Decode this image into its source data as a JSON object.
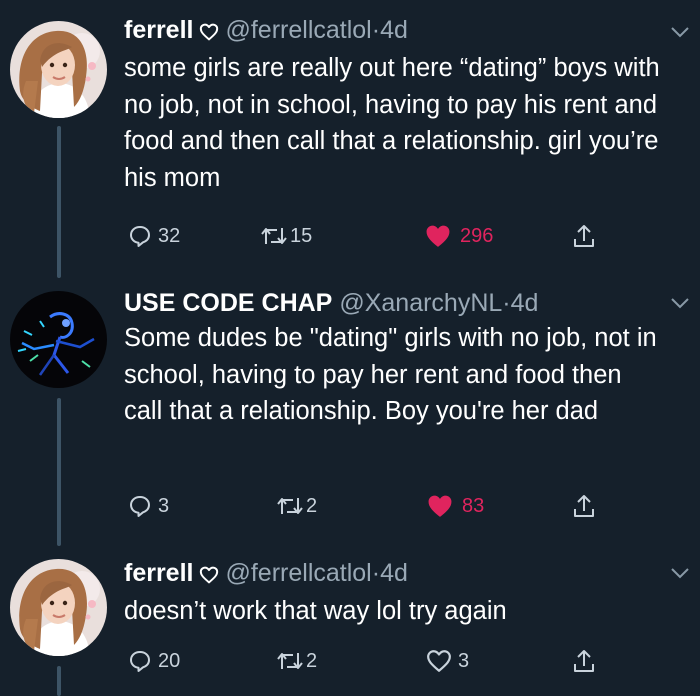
{
  "tweets": [
    {
      "name": "ferrell",
      "handle": "@ferrellcatlol",
      "separator": "·",
      "time": "4d",
      "body": "some girls are really out here “dating” boys with no job, not in school, having to pay his rent and food and then call that a relationship. girl you’re his mom",
      "replies": "32",
      "retweets": "15",
      "likes": "296",
      "liked": true,
      "avatar": "portrait-avatar"
    },
    {
      "name": "USE CODE CHAP",
      "handle": "@XanarchyNL",
      "separator": "·",
      "time": "4d",
      "body": "Some dudes be \"dating\" girls with no job, not in school, having to pay her rent and food then call that a relationship. Boy you're her dad",
      "replies": "3",
      "retweets": "2",
      "likes": "83",
      "liked": true,
      "avatar": "neon-figure-avatar"
    },
    {
      "name": "ferrell",
      "handle": "@ferrellcatlol",
      "separator": "·",
      "time": "4d",
      "body": "doesn’t work that way lol try again",
      "replies": "20",
      "retweets": "2",
      "likes": "3",
      "liked": false,
      "avatar": "portrait-avatar"
    }
  ],
  "colors": {
    "background": "#15202b",
    "secondary_text": "#9aa9b6",
    "like_red": "#e0245e",
    "thread_line": "#3d5466"
  }
}
